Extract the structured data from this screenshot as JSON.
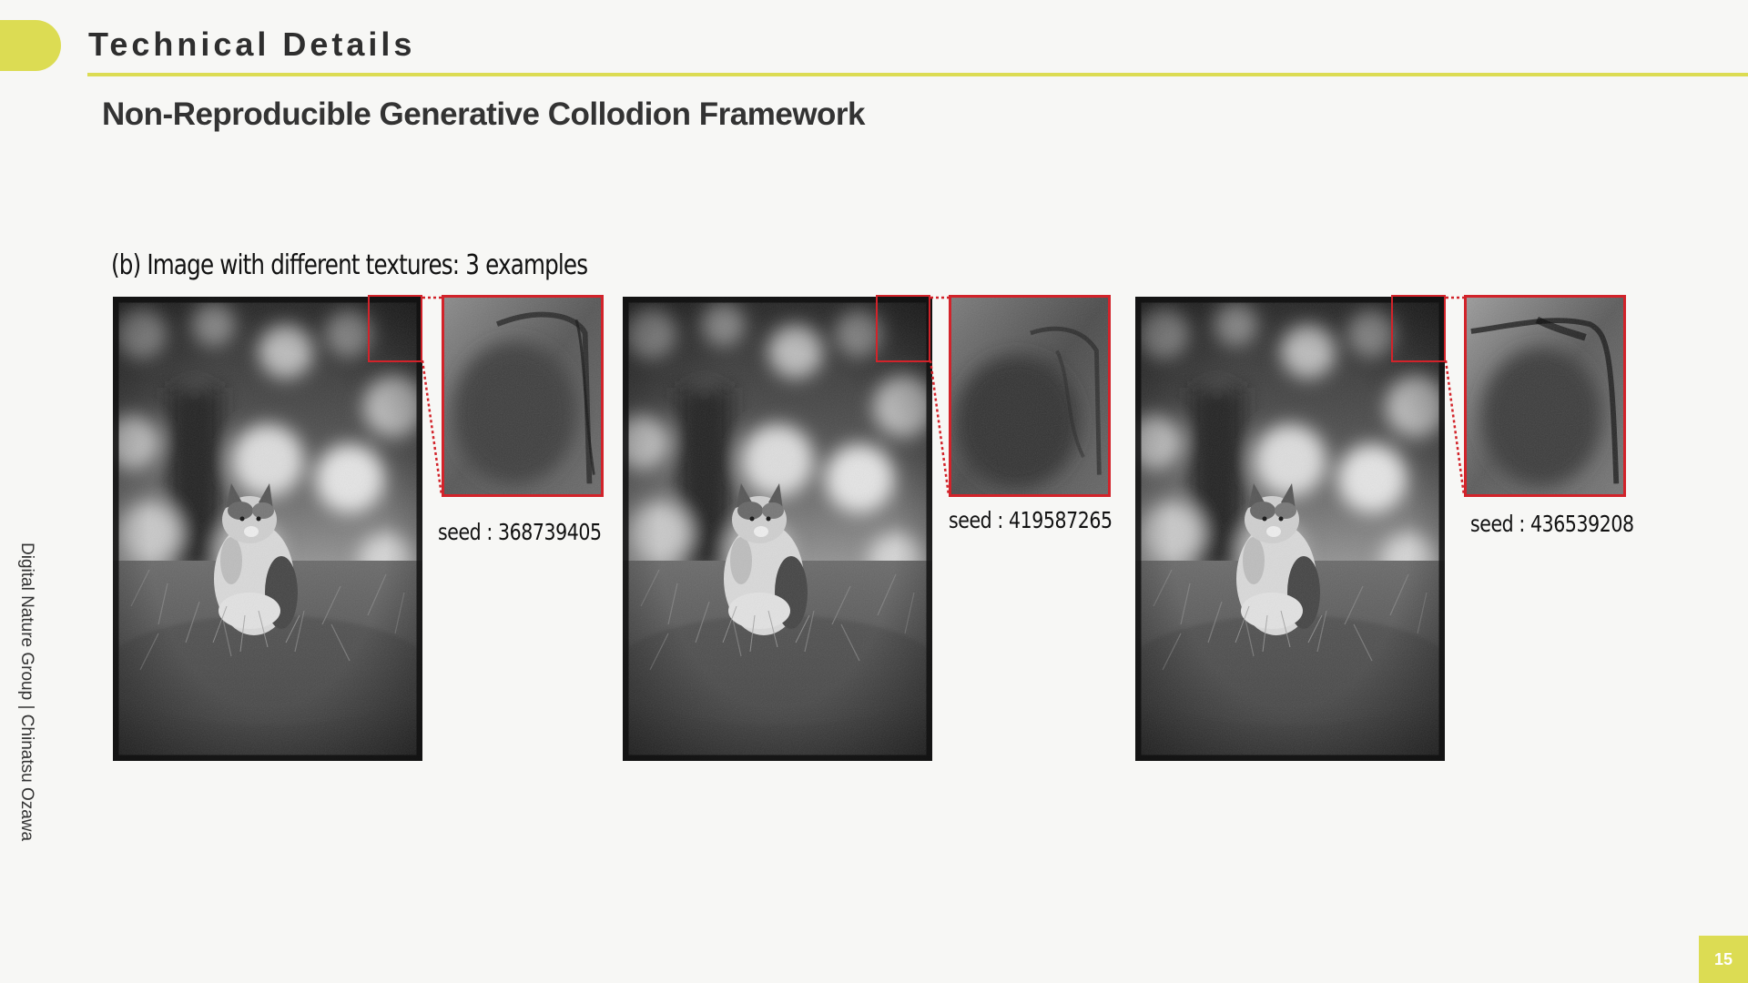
{
  "header": {
    "section_title": "Technical Details",
    "subtitle": "Non-Reproducible Generative Collodion Framework"
  },
  "figure": {
    "caption": "(b) Image with different textures: 3 examples",
    "examples": [
      {
        "seed_label": "seed : 368739405"
      },
      {
        "seed_label": "seed : 419587265"
      },
      {
        "seed_label": "seed : 436539208"
      }
    ]
  },
  "sidebar": {
    "credit": "Digital Nature Group | Chinatsu Ozawa"
  },
  "footer": {
    "page_number": "15"
  },
  "colors": {
    "accent": "#dcdc53",
    "highlight": "#d2232a"
  }
}
